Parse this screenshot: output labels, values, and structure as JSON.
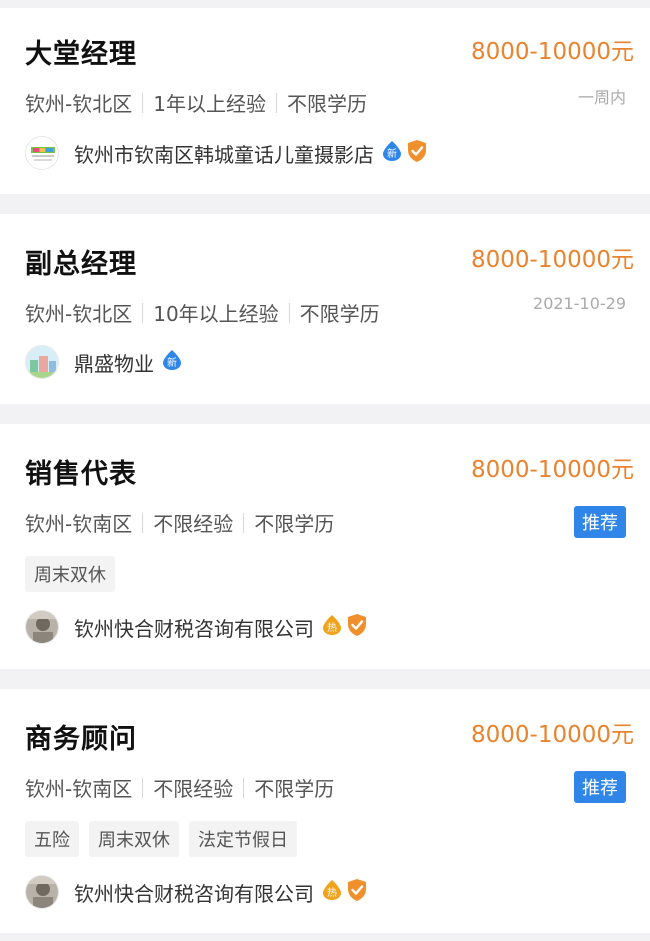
{
  "jobs": [
    {
      "title": "大堂经理",
      "salary": "8000-10000元",
      "location": "钦州-钦北区",
      "experience": "1年以上经验",
      "education": "不限学历",
      "posted": "一周内",
      "tags": [],
      "company": "钦州市钦南区韩城童话儿童摄影店",
      "company_badges": [
        "new",
        "verified"
      ]
    },
    {
      "title": "副总经理",
      "salary": "8000-10000元",
      "location": "钦州-钦北区",
      "experience": "10年以上经验",
      "education": "不限学历",
      "posted": "2021-10-29",
      "tags": [],
      "company": "鼎盛物业",
      "company_badges": [
        "new"
      ]
    },
    {
      "title": "销售代表",
      "salary": "8000-10000元",
      "location": "钦州-钦南区",
      "experience": "不限经验",
      "education": "不限学历",
      "badge": "推荐",
      "tags": [
        "周末双休"
      ],
      "company": "钦州快合财税咨询有限公司",
      "company_badges": [
        "hot",
        "verified"
      ]
    },
    {
      "title": "商务顾问",
      "salary": "8000-10000元",
      "location": "钦州-钦南区",
      "experience": "不限经验",
      "education": "不限学历",
      "badge": "推荐",
      "tags": [
        "五险",
        "周末双休",
        "法定节假日"
      ],
      "company": "钦州快合财税咨询有限公司",
      "company_badges": [
        "hot",
        "verified"
      ]
    }
  ],
  "badge_labels": {
    "new": "新",
    "hot": "热"
  },
  "colors": {
    "salary": "#e8832e",
    "recommend": "#2f86e8",
    "verified": "#f0902d",
    "new": "#2f86e8",
    "hot": "#f0a21d"
  }
}
